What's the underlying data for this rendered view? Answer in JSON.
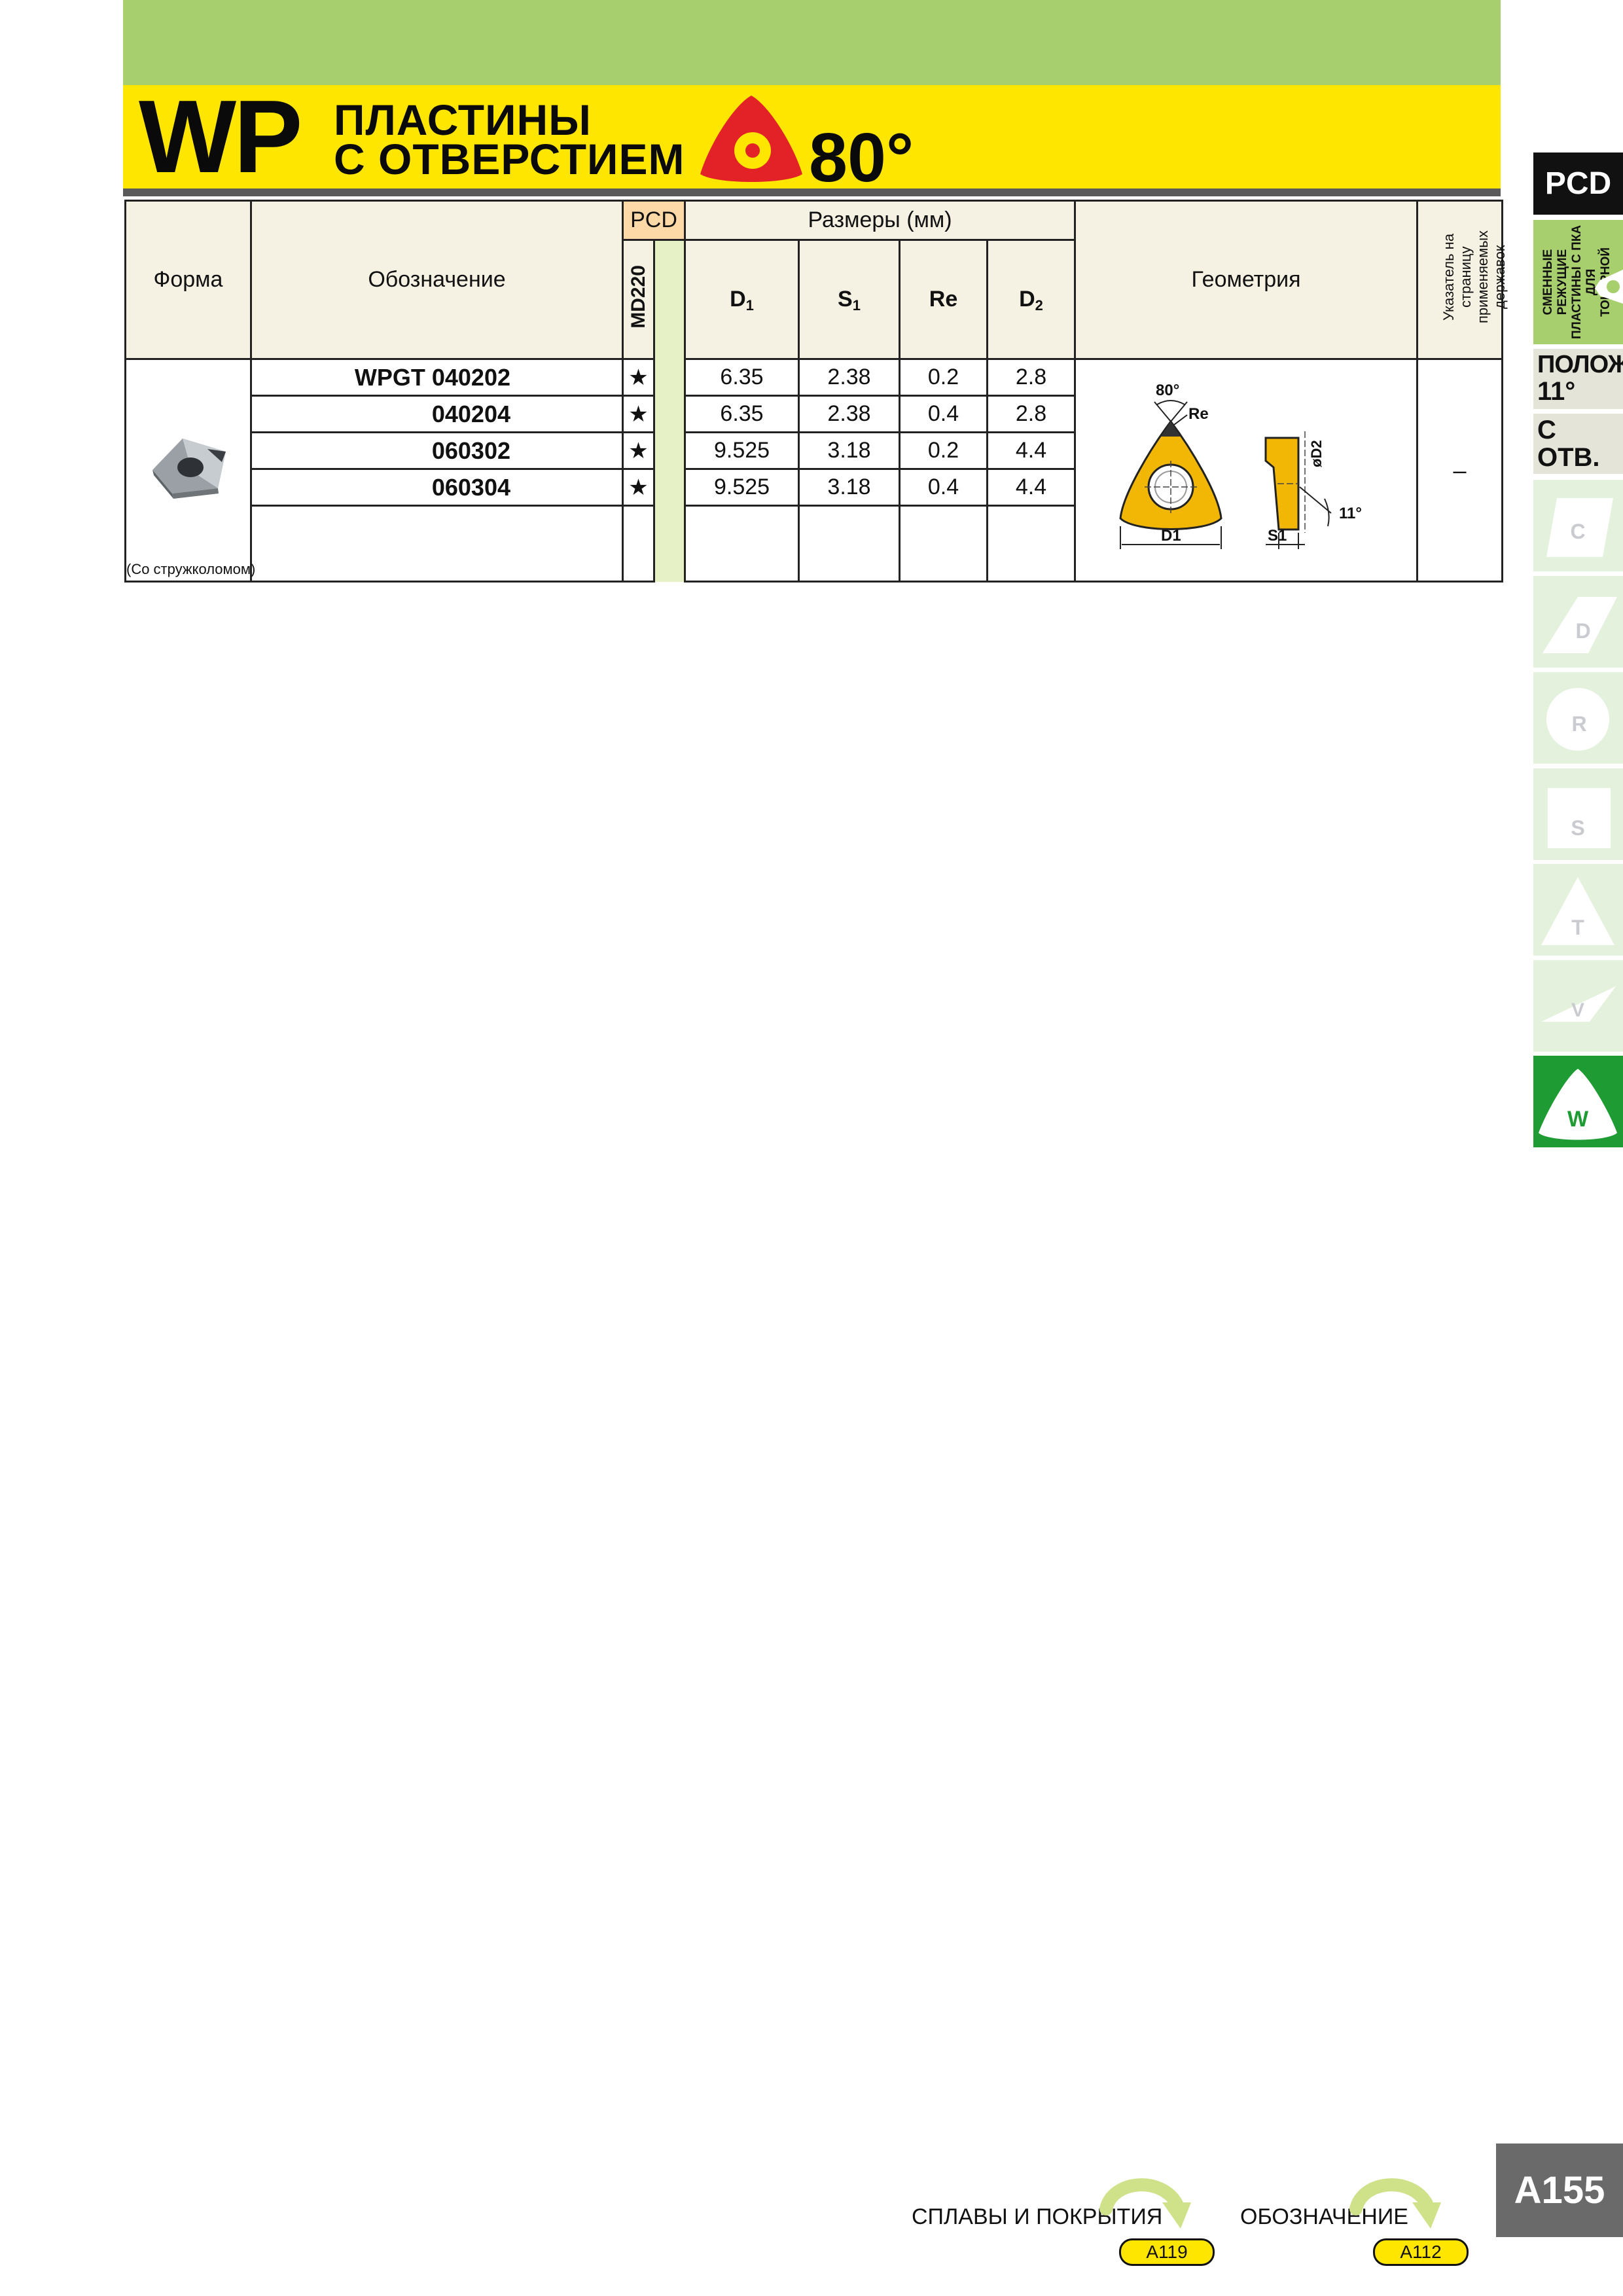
{
  "header": {
    "code": "WP",
    "title_line1": "ПЛАСТИНЫ",
    "title_line2": "С ОТВЕРСТИЕМ",
    "angle": "80°"
  },
  "table": {
    "col_shape": "Форма",
    "col_designation": "Обозначение",
    "col_pcd": "PCD",
    "col_grade": "MD220",
    "col_dimensions": "Размеры (мм)",
    "col_d1": "D",
    "col_d1_sub": "1",
    "col_s1": "S",
    "col_s1_sub": "1",
    "col_re": "Re",
    "col_d2": "D",
    "col_d2_sub": "2",
    "col_geometry": "Геометрия",
    "col_holder_ref": "Указатель на страницу применяемых державок",
    "shape_caption": "(Со стружколомом)",
    "holder_ref_value": "–",
    "rows": [
      {
        "designation": "WPGT 040202",
        "grade": "★",
        "d1": "6.35",
        "s1": "2.38",
        "re": "0.2",
        "d2": "2.8"
      },
      {
        "designation": "040204",
        "grade": "★",
        "d1": "6.35",
        "s1": "2.38",
        "re": "0.4",
        "d2": "2.8"
      },
      {
        "designation": "060302",
        "grade": "★",
        "d1": "9.525",
        "s1": "3.18",
        "re": "0.2",
        "d2": "4.4"
      },
      {
        "designation": "060304",
        "grade": "★",
        "d1": "9.525",
        "s1": "3.18",
        "re": "0.4",
        "d2": "4.4"
      }
    ],
    "diagram": {
      "angle": "80°",
      "re": "Re",
      "d1": "D1",
      "s1": "S1",
      "d2": "øD2",
      "clearance": "11°"
    }
  },
  "sidebar": {
    "pcd": "PCD",
    "replace_line1": "СМЕННЫЕ РЕЖУЩИЕ",
    "replace_line2": "ПЛАСТИНЫ С ПКА ДЛЯ",
    "replace_line3": "ТОКАРНОЙ ОБРАБОТКИ",
    "positive_line1": "ПОЛОЖ.",
    "positive_line2": "11°",
    "hole_line1": "С",
    "hole_line2": "ОТВ.",
    "shapes": [
      "C",
      "D",
      "R",
      "S",
      "T",
      "V",
      "W"
    ]
  },
  "footer": {
    "page_number": "A155",
    "link1_label": "СПЛАВЫ И ПОКРЫТИЯ",
    "link1_page": "A119",
    "link2_label": "ОБОЗНАЧЕНИЕ",
    "link2_page": "A112"
  }
}
